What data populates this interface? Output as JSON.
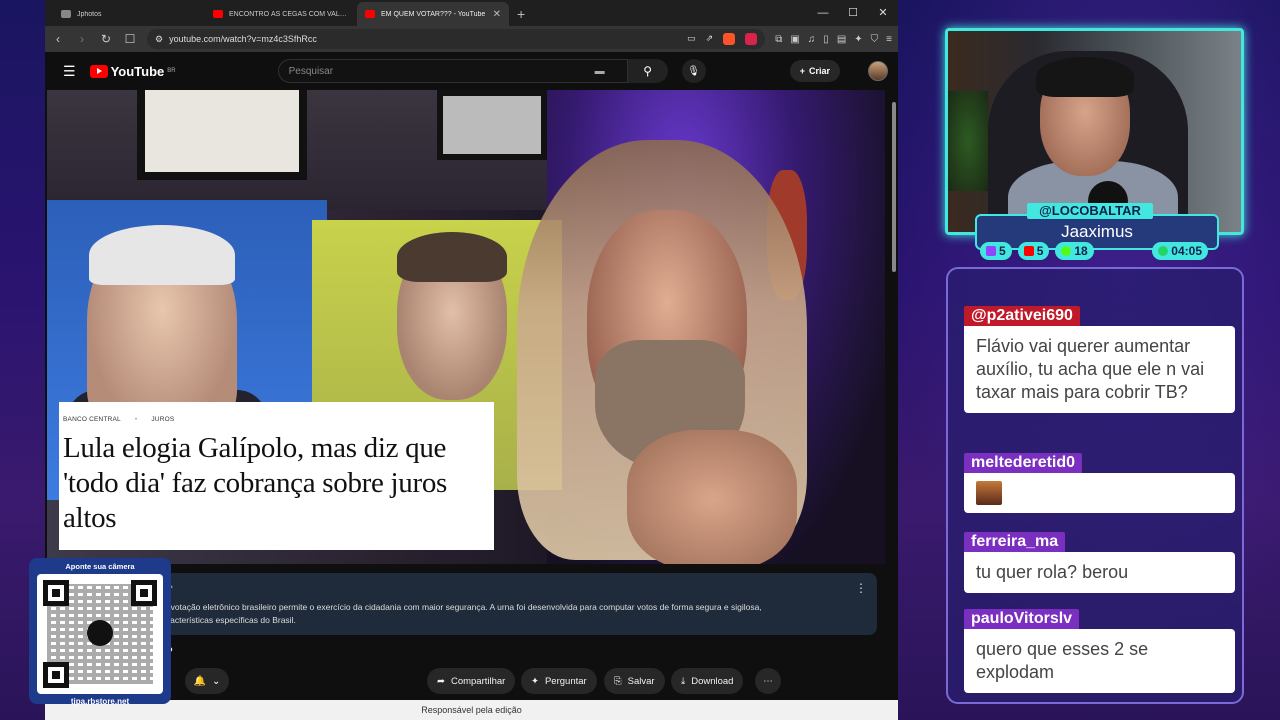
{
  "browser": {
    "tabs": [
      {
        "label": "Jphotos",
        "fav_color": "#888888"
      },
      {
        "label": "ENCONTRO ÀS CEGAS COM VALENTINA BA...",
        "fav_color": "#ff0000"
      },
      {
        "label": "EM QUEM VOTAR??? - YouTube",
        "fav_color": "#ff0000",
        "active": true
      }
    ],
    "new_tab": "+",
    "url": "youtube.com/watch?v=mz4c3SfhRcc"
  },
  "youtube": {
    "logo": "YouTube",
    "region": "BR",
    "search_placeholder": "Pesquisar",
    "create_label": "Criar",
    "video": {
      "caption_tags": [
        "BANCO CENTRAL",
        "•",
        "JUROS"
      ],
      "caption_title": "Lula elogia Galípolo, mas diz que 'todo dia' faz cobrança sobre juros altos"
    },
    "description": {
      "link": "rasil ↗",
      "text_line1": "na de votação eletrônico brasileiro permite o exercício da cidadania com maior segurança. A urna foi desenvolvida para computar votos de forma segura e sigilosa,",
      "text_line2": "as características específicas do Brasil."
    },
    "title_fragment": "?",
    "actions": {
      "share": "Compartilhar",
      "ask": "Perguntar",
      "save": "Salvar",
      "download": "Download"
    },
    "bottom_bar": "Responsável pela edição"
  },
  "qr_overlay": {
    "top": "Aponte sua câmera",
    "bottom": "tipa.rbstore.net"
  },
  "streamer": {
    "handle": "@LOCOBALTAR",
    "name": "Jaaximus",
    "stats": [
      {
        "icon": "twitch-icon",
        "value": "5",
        "color": "#9146ff"
      },
      {
        "icon": "youtube-icon",
        "value": "5",
        "color": "#ff0000"
      },
      {
        "icon": "kick-icon",
        "value": "18",
        "color": "#53fc18"
      },
      {
        "icon": "clock-icon",
        "value": "04:05",
        "color": "#25d366"
      }
    ]
  },
  "chat": [
    {
      "user": "@p2ativei690",
      "color": "#c0192a",
      "message": "Flávio vai querer aumentar auxílio, tu acha que ele n vai taxar mais para cobrir TB?"
    },
    {
      "user": "meltederetid0",
      "color": "#7a2fc0",
      "message": "",
      "emote": true
    },
    {
      "user": "ferreira_ma",
      "color": "#7a2fc0",
      "message": "tu quer rola? berou"
    },
    {
      "user": "pauloVitorslv",
      "color": "#7a2fc0",
      "message": "quero que esses 2 se explodam"
    }
  ]
}
